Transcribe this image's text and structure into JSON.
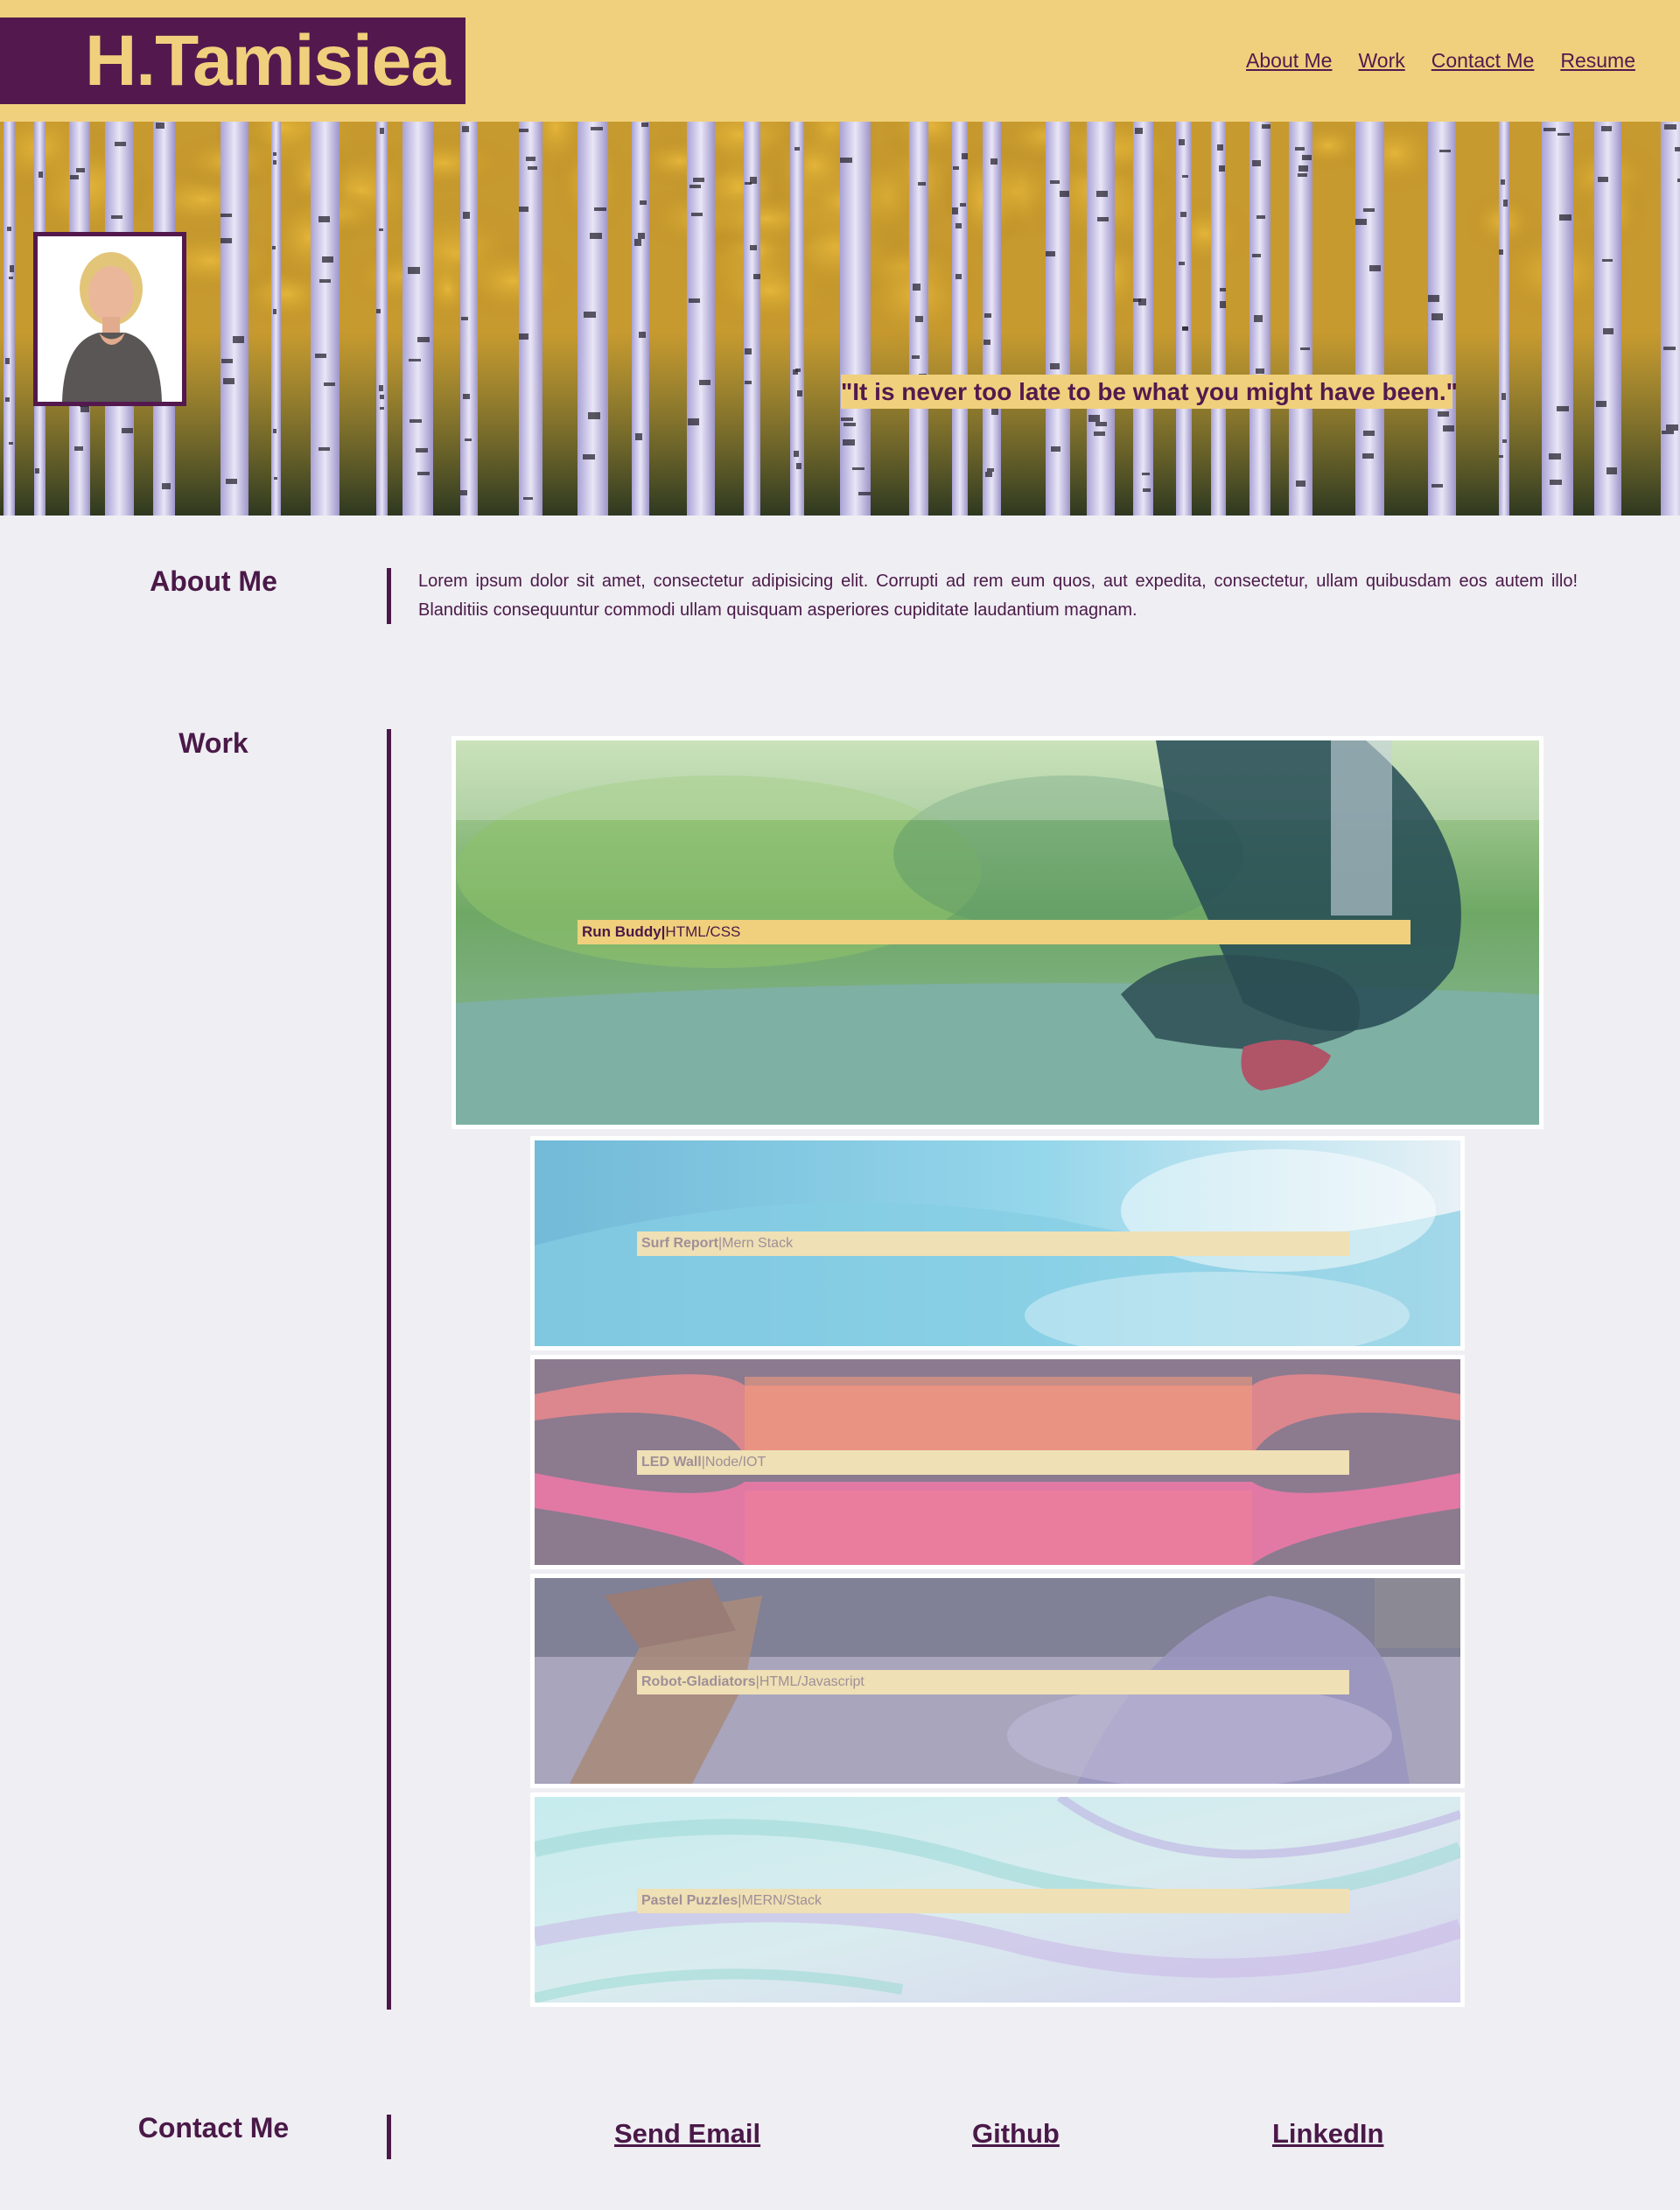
{
  "header": {
    "logo": "H.Tamisiea",
    "nav": [
      {
        "label": "About Me"
      },
      {
        "label": "Work"
      },
      {
        "label": "Contact Me"
      },
      {
        "label": "Resume"
      }
    ]
  },
  "hero": {
    "quote": "\"It is never too late to be what you might have been.\""
  },
  "about": {
    "title": "About Me",
    "text": "Lorem ipsum dolor sit amet, consectetur adipisicing elit. Corrupti ad rem eum quos, aut expedita, consectetur, ullam quibusdam eos autem illo! Blanditiis consequuntur commodi ullam quisquam asperiores cupiditate laudantium magnam."
  },
  "work": {
    "title": "Work",
    "projects": [
      {
        "name": "Run Buddy",
        "sep": "|",
        "tech": "HTML/CSS"
      },
      {
        "name": "Surf Report",
        "sep": "|",
        "tech": "Mern Stack"
      },
      {
        "name": "LED Wall",
        "sep": "|",
        "tech": "Node/IOT"
      },
      {
        "name": "Robot-Gladiators",
        "sep": "|",
        "tech": "HTML/Javascript"
      },
      {
        "name": "Pastel Puzzles",
        "sep": "|",
        "tech": "MERN/Stack"
      }
    ]
  },
  "contact": {
    "title": "Contact Me",
    "links": [
      {
        "label": "Send Email"
      },
      {
        "label": "Github"
      },
      {
        "label": "LinkedIn"
      }
    ]
  },
  "colors": {
    "accent_yellow": "#f0d07c",
    "brand_purple": "#53194e",
    "background": "#efeef3"
  }
}
